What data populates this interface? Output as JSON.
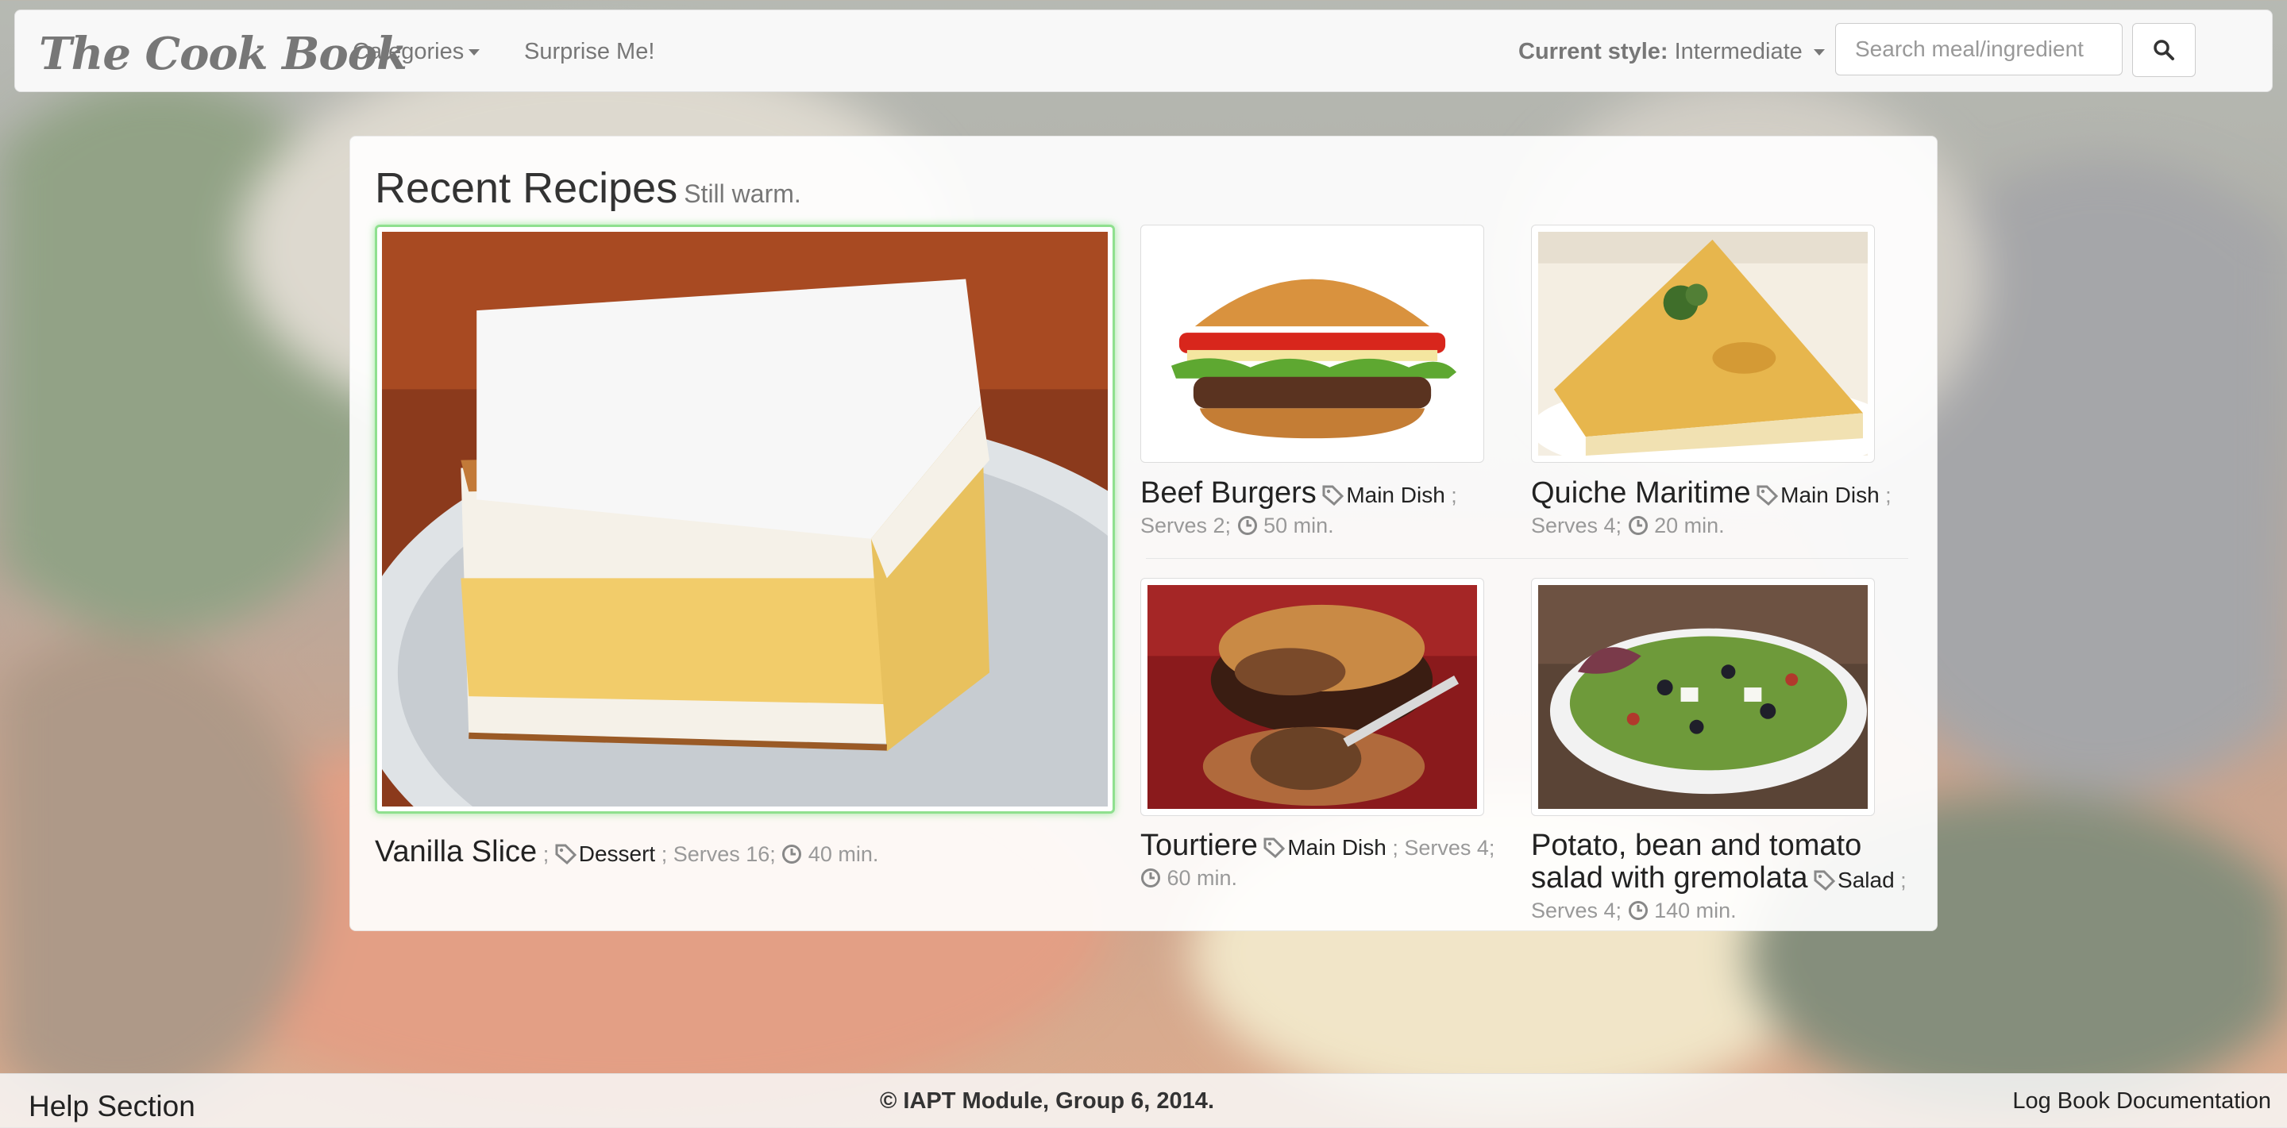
{
  "navbar": {
    "brand": "The Cook Book",
    "categories": "Categories",
    "surprise": "Surprise Me!",
    "style_label": "Current style:",
    "style_value": "Intermediate",
    "search_placeholder": "Search meal/ingredient",
    "search_icon": "search-icon"
  },
  "recent": {
    "heading": "Recent Recipes",
    "subheading": "Still warm.",
    "featured": {
      "title": "Vanilla Slice",
      "sep1": " ;",
      "category": "Dessert",
      "serves": " ; Serves 16;",
      "time": "40 min."
    },
    "items": [
      {
        "title": "Beef Burgers",
        "category": "Main Dish",
        "sep": " ;",
        "serves": "Serves 2;",
        "time": "50 min."
      },
      {
        "title": "Quiche Maritime",
        "category": "Main Dish",
        "sep": " ;",
        "serves": "Serves 4;",
        "time": "20 min."
      },
      {
        "title": "Tourtiere",
        "category": "Main Dish",
        "sep": " ; Serves 4;",
        "serves": "",
        "time": "60 min."
      },
      {
        "title": "Potato, bean and tomato salad with gremolata",
        "category": "Salad",
        "sep": " ;",
        "serves": "Serves 4;",
        "time": "140 min."
      }
    ]
  },
  "footer": {
    "help": "Help Section",
    "copyright": "© IAPT Module, Group 6, 2014.",
    "docs": "Log Book Documentation"
  },
  "colors": {
    "featured_border": "#8fe08f",
    "muted_text": "#999999",
    "navbar_bg": "#f8f8f8"
  }
}
